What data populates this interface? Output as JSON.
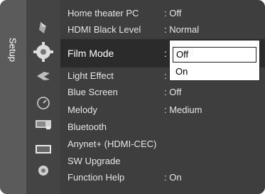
{
  "sidebar": {
    "label": "Setup"
  },
  "icons": [
    {
      "name": "picture-icon"
    },
    {
      "name": "setup-gear-icon"
    },
    {
      "name": "input-icon"
    },
    {
      "name": "clock-icon"
    },
    {
      "name": "channel-icon"
    },
    {
      "name": "screen-icon"
    },
    {
      "name": "sound-icon"
    }
  ],
  "menu": {
    "items": [
      {
        "label": "Home theater PC",
        "value": ": Off"
      },
      {
        "label": "HDMI Black Level",
        "value": ": Normal"
      },
      {
        "label": "Film Mode",
        "value": ":"
      },
      {
        "label": "Light Effect",
        "value": ":"
      },
      {
        "label": "Blue Screen",
        "value": ": Off"
      },
      {
        "label": "Melody",
        "value": ": Medium"
      },
      {
        "label": "Bluetooth",
        "value": ""
      },
      {
        "label": "Anynet+ (HDMI-CEC)",
        "value": ""
      },
      {
        "label": "SW Upgrade",
        "value": ""
      },
      {
        "label": "Function Help",
        "value": ": On"
      }
    ]
  },
  "dropdown": {
    "options": [
      "Off",
      "On"
    ],
    "selected": "Off"
  },
  "colors": {
    "panel": "#4a4a4a",
    "selected_row": "#2b2b2b",
    "text": "#e6e6e6",
    "dropdown_bg": "#ffffff"
  }
}
